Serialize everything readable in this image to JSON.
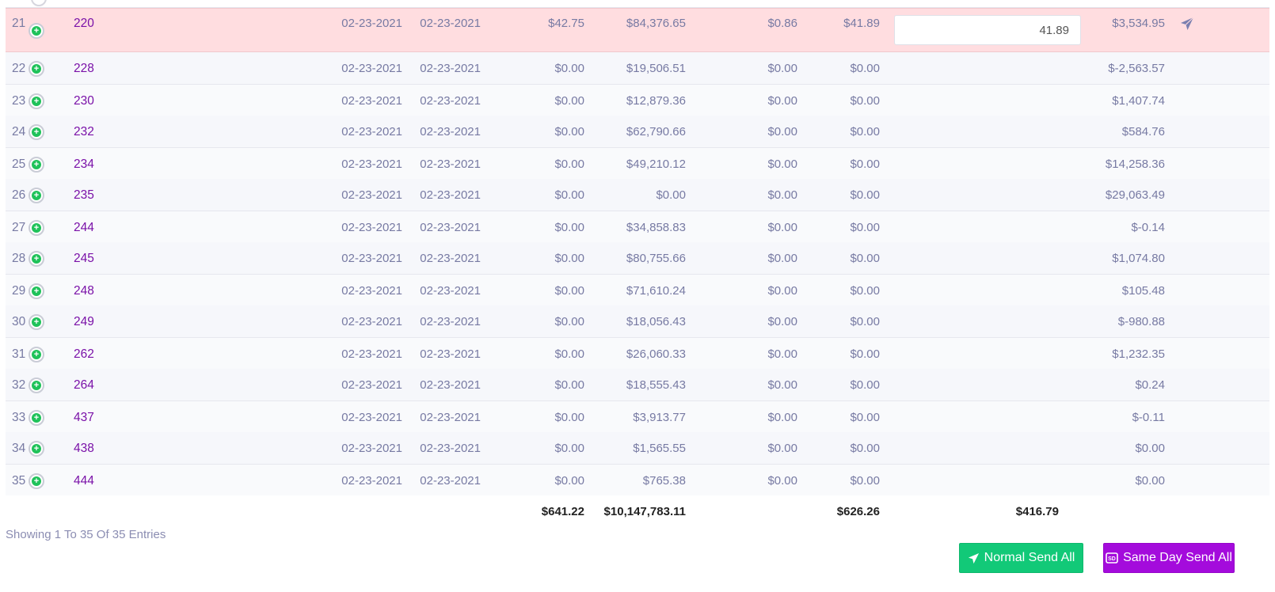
{
  "table": {
    "rows": [
      {
        "num": "21",
        "id": "220",
        "date1": "02-23-2021",
        "date2": "02-23-2021",
        "a1": "$42.75",
        "a2": "$84,376.65",
        "a3": "$0.86",
        "a4": "$41.89",
        "input_value": "41.89",
        "balance": "$3,534.95",
        "highlight": true
      },
      {
        "num": "22",
        "id": "228",
        "date1": "02-23-2021",
        "date2": "02-23-2021",
        "a1": "$0.00",
        "a2": "$19,506.51",
        "a3": "$0.00",
        "a4": "$0.00",
        "balance": "$-2,563.57"
      },
      {
        "num": "23",
        "id": "230",
        "date1": "02-23-2021",
        "date2": "02-23-2021",
        "a1": "$0.00",
        "a2": "$12,879.36",
        "a3": "$0.00",
        "a4": "$0.00",
        "balance": "$1,407.74"
      },
      {
        "num": "24",
        "id": "232",
        "date1": "02-23-2021",
        "date2": "02-23-2021",
        "a1": "$0.00",
        "a2": "$62,790.66",
        "a3": "$0.00",
        "a4": "$0.00",
        "balance": "$584.76"
      },
      {
        "num": "25",
        "id": "234",
        "date1": "02-23-2021",
        "date2": "02-23-2021",
        "a1": "$0.00",
        "a2": "$49,210.12",
        "a3": "$0.00",
        "a4": "$0.00",
        "balance": "$14,258.36"
      },
      {
        "num": "26",
        "id": "235",
        "date1": "02-23-2021",
        "date2": "02-23-2021",
        "a1": "$0.00",
        "a2": "$0.00",
        "a3": "$0.00",
        "a4": "$0.00",
        "balance": "$29,063.49"
      },
      {
        "num": "27",
        "id": "244",
        "date1": "02-23-2021",
        "date2": "02-23-2021",
        "a1": "$0.00",
        "a2": "$34,858.83",
        "a3": "$0.00",
        "a4": "$0.00",
        "balance": "$-0.14"
      },
      {
        "num": "28",
        "id": "245",
        "date1": "02-23-2021",
        "date2": "02-23-2021",
        "a1": "$0.00",
        "a2": "$80,755.66",
        "a3": "$0.00",
        "a4": "$0.00",
        "balance": "$1,074.80"
      },
      {
        "num": "29",
        "id": "248",
        "date1": "02-23-2021",
        "date2": "02-23-2021",
        "a1": "$0.00",
        "a2": "$71,610.24",
        "a3": "$0.00",
        "a4": "$0.00",
        "balance": "$105.48"
      },
      {
        "num": "30",
        "id": "249",
        "date1": "02-23-2021",
        "date2": "02-23-2021",
        "a1": "$0.00",
        "a2": "$18,056.43",
        "a3": "$0.00",
        "a4": "$0.00",
        "balance": "$-980.88"
      },
      {
        "num": "31",
        "id": "262",
        "date1": "02-23-2021",
        "date2": "02-23-2021",
        "a1": "$0.00",
        "a2": "$26,060.33",
        "a3": "$0.00",
        "a4": "$0.00",
        "balance": "$1,232.35"
      },
      {
        "num": "32",
        "id": "264",
        "date1": "02-23-2021",
        "date2": "02-23-2021",
        "a1": "$0.00",
        "a2": "$18,555.43",
        "a3": "$0.00",
        "a4": "$0.00",
        "balance": "$0.24"
      },
      {
        "num": "33",
        "id": "437",
        "date1": "02-23-2021",
        "date2": "02-23-2021",
        "a1": "$0.00",
        "a2": "$3,913.77",
        "a3": "$0.00",
        "a4": "$0.00",
        "balance": "$-0.11"
      },
      {
        "num": "34",
        "id": "438",
        "date1": "02-23-2021",
        "date2": "02-23-2021",
        "a1": "$0.00",
        "a2": "$1,565.55",
        "a3": "$0.00",
        "a4": "$0.00",
        "balance": "$0.00"
      },
      {
        "num": "35",
        "id": "444",
        "date1": "02-23-2021",
        "date2": "02-23-2021",
        "a1": "$0.00",
        "a2": "$765.38",
        "a3": "$0.00",
        "a4": "$0.00",
        "balance": "$0.00"
      }
    ],
    "totals": {
      "a1": "$641.22",
      "a2": "$10,147,783.11",
      "a4": "$626.26",
      "input_total": "$416.79"
    }
  },
  "footer": {
    "entries_text": "Showing 1 To 35 Of 35 Entries",
    "normal_send_label": "Normal Send All",
    "same_day_send_label": "Same Day Send All"
  },
  "icons": {
    "add": "plus-circle-icon",
    "send": "paper-plane-icon",
    "same_day": "sd-card-icon"
  },
  "colors": {
    "highlight_row": "#ffdde0",
    "id_link": "#7a11a8",
    "add_icon": "#1fc25a",
    "normal_send_btn": "#12c978",
    "same_day_btn": "#a40bdc"
  }
}
